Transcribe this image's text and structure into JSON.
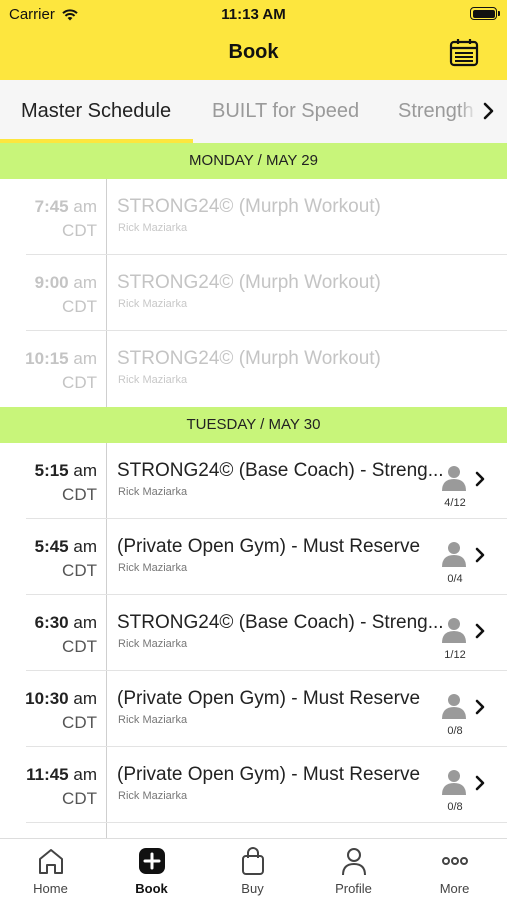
{
  "status_bar": {
    "carrier": "Carrier",
    "time": "11:13 AM"
  },
  "nav": {
    "title": "Book",
    "calendar_icon": "calendar-icon"
  },
  "tabs": [
    {
      "label": "Master Schedule",
      "active": true
    },
    {
      "label": "BUILT for Speed",
      "active": false
    },
    {
      "label": "Strength",
      "active": false
    }
  ],
  "days": [
    {
      "header": "MONDAY / MAY 29",
      "classes": [
        {
          "time": "7:45",
          "ampm": "am",
          "tz": "CDT",
          "title": "STRONG24© (Murph Workout)",
          "coach": "Rick Maziarka",
          "past": true
        },
        {
          "time": "9:00",
          "ampm": "am",
          "tz": "CDT",
          "title": "STRONG24© (Murph Workout)",
          "coach": "Rick Maziarka",
          "past": true
        },
        {
          "time": "10:15",
          "ampm": "am",
          "tz": "CDT",
          "title": "STRONG24© (Murph Workout)",
          "coach": "Rick Maziarka",
          "past": true
        }
      ]
    },
    {
      "header": "TUESDAY / MAY 30",
      "classes": [
        {
          "time": "5:15",
          "ampm": "am",
          "tz": "CDT",
          "title": "STRONG24© (Base Coach) - Streng...",
          "coach": "Rick Maziarka",
          "capacity": "4/12"
        },
        {
          "time": "5:45",
          "ampm": "am",
          "tz": "CDT",
          "title": "(Private Open Gym) - Must Reserve",
          "coach": "Rick Maziarka",
          "capacity": "0/4"
        },
        {
          "time": "6:30",
          "ampm": "am",
          "tz": "CDT",
          "title": "STRONG24© (Base Coach) - Streng...",
          "coach": "Rick Maziarka",
          "capacity": "1/12"
        },
        {
          "time": "10:30",
          "ampm": "am",
          "tz": "CDT",
          "title": "(Private Open Gym) - Must Reserve",
          "coach": "Rick Maziarka",
          "capacity": "0/8"
        },
        {
          "time": "11:45",
          "ampm": "am",
          "tz": "CDT",
          "title": "(Private Open Gym) - Must Reserve",
          "coach": "Rick Maziarka",
          "capacity": "0/8"
        }
      ]
    }
  ],
  "bottom_tabs": [
    {
      "label": "Home",
      "icon": "home-icon"
    },
    {
      "label": "Book",
      "icon": "plus-square-icon",
      "active": true
    },
    {
      "label": "Buy",
      "icon": "shopping-bag-icon"
    },
    {
      "label": "Profile",
      "icon": "person-icon"
    },
    {
      "label": "More",
      "icon": "more-dots-icon"
    }
  ],
  "colors": {
    "brand_yellow": "#fde63e",
    "day_header_green": "#c8f57a"
  }
}
